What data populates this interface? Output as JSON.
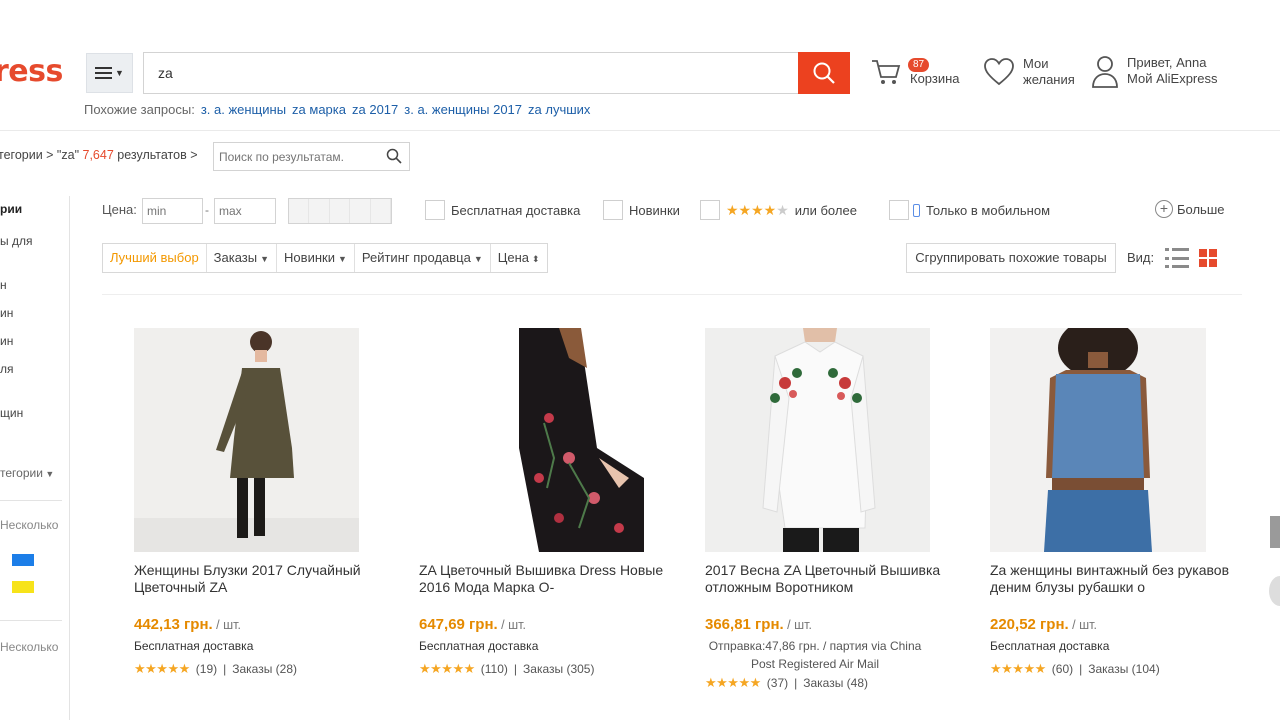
{
  "header": {
    "logo": "ress",
    "search_value": "za",
    "cart": {
      "badge": "87",
      "label": "Корзина"
    },
    "wishlist": {
      "line1": "Мои",
      "line2": "желания"
    },
    "account": {
      "line1": "Привет, Anna",
      "line2": "Мой AliExpress"
    }
  },
  "related": {
    "label": "Похожие запросы:",
    "links": [
      "з. а. женщины",
      "za марка",
      "za 2017",
      "з. а. женщины 2017",
      "za лучших"
    ]
  },
  "breadcrumb": {
    "prefix": "тегории > \"za\" ",
    "count": "7,647",
    "suffix": " результатов >",
    "search_placeholder": "Поиск по результатам."
  },
  "sidebar": {
    "items": [
      "рии",
      "ы для",
      "н",
      "ин",
      "ин",
      "ля",
      "щин",
      "тегории",
      "Несколько",
      "Несколько"
    ]
  },
  "filters": {
    "price_label": "Цена:",
    "min_placeholder": "min",
    "max_placeholder": "max",
    "free_shipping": "Бесплатная доставка",
    "new_items": "Новинки",
    "rating_suffix": "или более",
    "mobile_only": "Только в мобильном",
    "more": "Больше"
  },
  "sort": {
    "options": [
      "Лучший выбор",
      "Заказы",
      "Новинки",
      "Рейтинг продавца",
      "Цена"
    ],
    "group_button": "Сгруппировать похожие товары",
    "view_label": "Вид:"
  },
  "products": [
    {
      "title": "Женщины Блузки 2017 Случайный Цветочный ZA",
      "price": "442,13 грн.",
      "unit": " / шт.",
      "shipping": "Бесплатная доставка",
      "reviews": "(19)",
      "orders": "Заказы (28)"
    },
    {
      "title": "ZA Цветочный Вышивка Dress Новые 2016 Мода Марка О-",
      "price": "647,69 грн.",
      "unit": " / шт.",
      "shipping": "Бесплатная доставка",
      "reviews": "(110)",
      "orders": "Заказы (305)"
    },
    {
      "title": "2017 Весна ZA Цветочный Вышивка отложным Воротником",
      "price": "366,81 грн.",
      "unit": " / шт.",
      "shipping": "Отправка:47,86 грн. / партия via China Post Registered Air Mail",
      "reviews": "(37)",
      "orders": "Заказы (48)"
    },
    {
      "title": "Za женщины винтажный без рукавов деним блузы рубашки о",
      "price": "220,52 грн.",
      "unit": " / шт.",
      "shipping": "Бесплатная доставка",
      "reviews": "(60)",
      "orders": "Заказы (104)"
    }
  ],
  "colors": {
    "brand": "#e64a2d",
    "price": "#e58a00",
    "link": "#1d5fa8",
    "star": "#f5a623"
  }
}
